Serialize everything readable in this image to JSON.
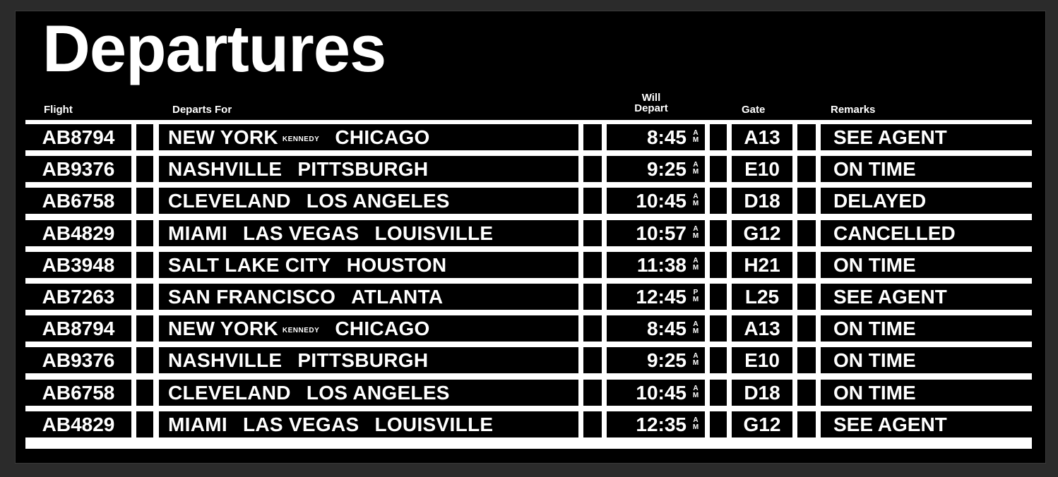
{
  "board": {
    "title": "Departures",
    "headers": {
      "flight": "Flight",
      "departs_for": "Departs For",
      "will_depart_line1": "Will",
      "will_depart_line2": "Depart",
      "gate": "Gate",
      "remarks": "Remarks"
    },
    "rows": [
      {
        "flight": "AB8794",
        "cities": [
          "NEW YORK",
          "CHICAGO"
        ],
        "city_sub": "KENNEDY",
        "time": "8:45",
        "ampm": [
          "A",
          "M"
        ],
        "gate": "A13",
        "remark": "SEE AGENT"
      },
      {
        "flight": "AB9376",
        "cities": [
          "NASHVILLE",
          "PITTSBURGH"
        ],
        "city_sub": "",
        "time": "9:25",
        "ampm": [
          "A",
          "M"
        ],
        "gate": "E10",
        "remark": "ON TIME"
      },
      {
        "flight": "AB6758",
        "cities": [
          "CLEVELAND",
          "LOS ANGELES"
        ],
        "city_sub": "",
        "time": "10:45",
        "ampm": [
          "A",
          "M"
        ],
        "gate": "D18",
        "remark": "DELAYED"
      },
      {
        "flight": "AB4829",
        "cities": [
          "MIAMI",
          "LAS VEGAS",
          "LOUISVILLE"
        ],
        "city_sub": "",
        "time": "10:57",
        "ampm": [
          "A",
          "M"
        ],
        "gate": "G12",
        "remark": "CANCELLED"
      },
      {
        "flight": "AB3948",
        "cities": [
          "SALT LAKE CITY",
          "HOUSTON"
        ],
        "city_sub": "",
        "time": "11:38",
        "ampm": [
          "A",
          "M"
        ],
        "gate": "H21",
        "remark": "ON TIME"
      },
      {
        "flight": "AB7263",
        "cities": [
          "SAN FRANCISCO",
          "ATLANTA"
        ],
        "city_sub": "",
        "time": "12:45",
        "ampm": [
          "P",
          "M"
        ],
        "gate": "L25",
        "remark": "SEE AGENT"
      },
      {
        "flight": "AB8794",
        "cities": [
          "NEW YORK",
          "CHICAGO"
        ],
        "city_sub": "KENNEDY",
        "time": "8:45",
        "ampm": [
          "A",
          "M"
        ],
        "gate": "A13",
        "remark": "ON TIME"
      },
      {
        "flight": "AB9376",
        "cities": [
          "NASHVILLE",
          "PITTSBURGH"
        ],
        "city_sub": "",
        "time": "9:25",
        "ampm": [
          "A",
          "M"
        ],
        "gate": "E10",
        "remark": "ON TIME"
      },
      {
        "flight": "AB6758",
        "cities": [
          "CLEVELAND",
          "LOS ANGELES"
        ],
        "city_sub": "",
        "time": "10:45",
        "ampm": [
          "A",
          "M"
        ],
        "gate": "D18",
        "remark": "ON TIME"
      },
      {
        "flight": "AB4829",
        "cities": [
          "MIAMI",
          "LAS VEGAS",
          "LOUISVILLE"
        ],
        "city_sub": "",
        "time": "12:35",
        "ampm": [
          "A",
          "M"
        ],
        "gate": "G12",
        "remark": "SEE AGENT"
      }
    ]
  },
  "colors": {
    "board_background": "#000000",
    "text": "#ffffff",
    "frame": "#2b2b2b"
  }
}
